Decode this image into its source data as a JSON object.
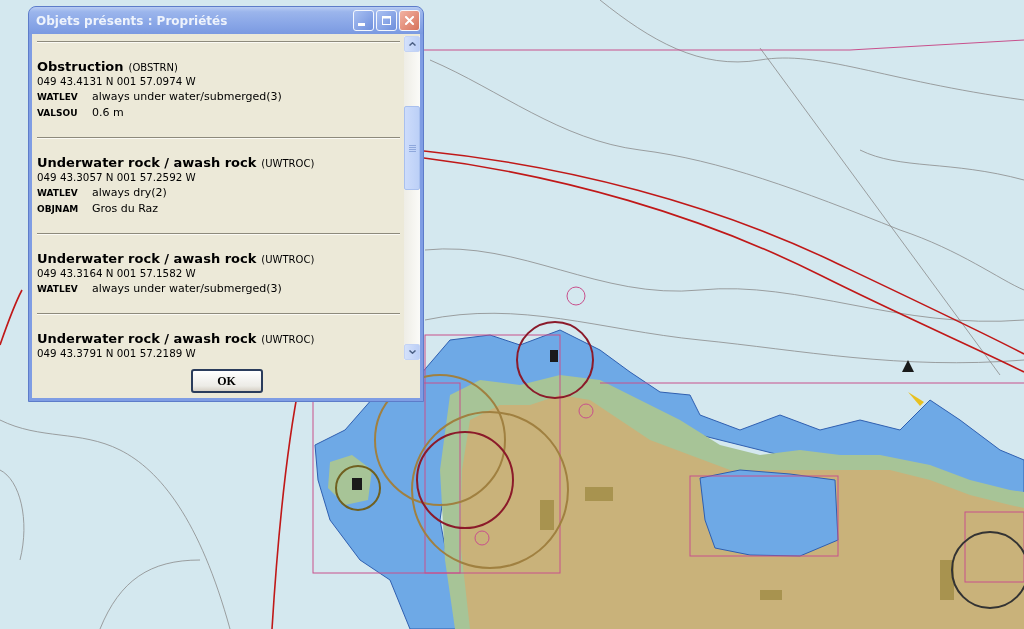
{
  "window": {
    "title": "Objets présents : Propriétés"
  },
  "objects": [
    {
      "name": "Obstruction",
      "code": "(OBSTRN)",
      "position": "049 43.4131 N 001 57.0974 W",
      "attributes": [
        {
          "key": "WATLEV",
          "value": "always under water/submerged(3)"
        },
        {
          "key": "VALSOU",
          "value": "0.6 m"
        }
      ]
    },
    {
      "name": "Underwater rock / awash rock",
      "code": "(UWTROC)",
      "position": "049 43.3057 N 001 57.2592 W",
      "attributes": [
        {
          "key": "WATLEV",
          "value": "always dry(2)"
        },
        {
          "key": "OBJNAM",
          "value": "Gros du Raz"
        }
      ]
    },
    {
      "name": "Underwater rock / awash rock",
      "code": "(UWTROC)",
      "position": "049 43.3164 N 001 57.1582 W",
      "attributes": [
        {
          "key": "WATLEV",
          "value": "always under water/submerged(3)"
        }
      ]
    },
    {
      "name": "Underwater rock / awash rock",
      "code": "(UWTROC)",
      "position": "049 43.3791 N 001 57.2189 W"
    }
  ],
  "buttons": [
    {
      "label": "OK"
    }
  ]
}
